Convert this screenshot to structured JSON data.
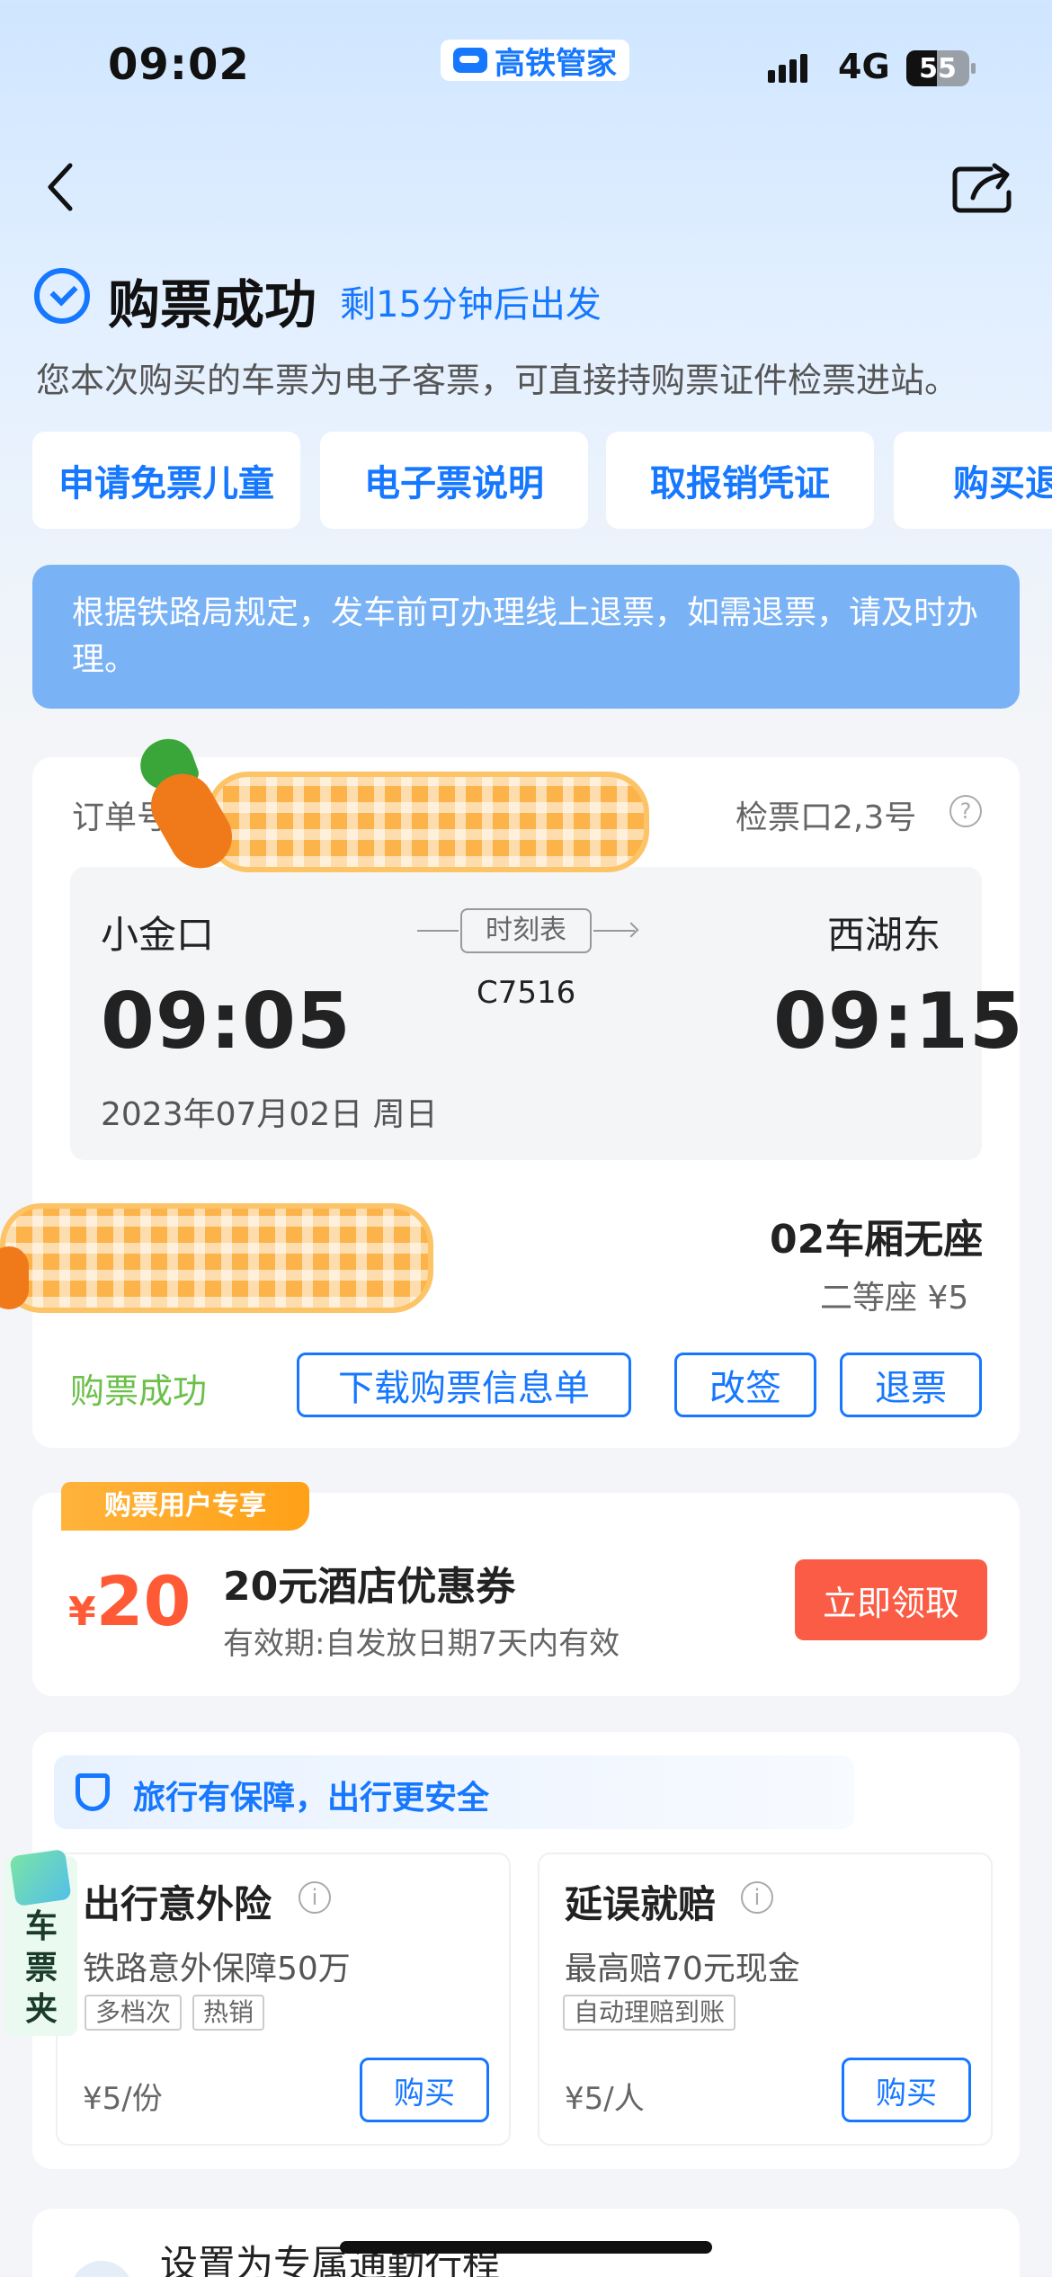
{
  "status_bar": {
    "time": "09:02",
    "app_name": "高铁管家",
    "network": "4G",
    "battery": "55"
  },
  "header": {
    "title": "购票成功",
    "subtitle": "剩15分钟后出发",
    "description": "您本次购买的车票为电子客票，可直接持购票证件检票进站。"
  },
  "actions": [
    "申请免票儿童",
    "电子票说明",
    "取报销凭证",
    "购买退"
  ],
  "notice": "根据铁路局规定，发车前可办理线上退票，如需退票，请及时办理。",
  "order": {
    "order_label": "订单号",
    "gate": "检票口2,3号",
    "from_station": "小金口",
    "to_station": "西湖东",
    "depart_time": "09:05",
    "arrive_time": "09:15",
    "schedule_label": "时刻表",
    "train_no": "C7516",
    "date": "2023年07月02日 周日",
    "car": "02车厢无座",
    "seat": "二等座 ¥5",
    "status": "购票成功",
    "buttons": {
      "download": "下载购票信息单",
      "change": "改签",
      "refund": "退票"
    }
  },
  "coupon": {
    "tag": "购票用户专享",
    "currency": "¥",
    "amount": "20",
    "title": "20元酒店优惠券",
    "validity": "有效期:自发放日期7天内有效",
    "button": "立即领取"
  },
  "insurance": {
    "banner": "旅行有保障，出行更安全",
    "items": [
      {
        "title": "出行意外险",
        "desc": "铁路意外保障50万",
        "tags": [
          "多档次",
          "热销"
        ],
        "price": "¥5/份",
        "button": "购买"
      },
      {
        "title": "延误就赔",
        "desc": "最高赔70元现金",
        "tags": [
          "自动理赔到账"
        ],
        "price": "¥5/人",
        "button": "购买"
      }
    ]
  },
  "wallet": "车票夹",
  "bottom": {
    "text": "设置为专属通勤行程"
  },
  "colors": {
    "brand": "#1677ff",
    "success": "#6cc04a",
    "coupon": "#fa5c45",
    "notice": "#7ab2f6"
  }
}
